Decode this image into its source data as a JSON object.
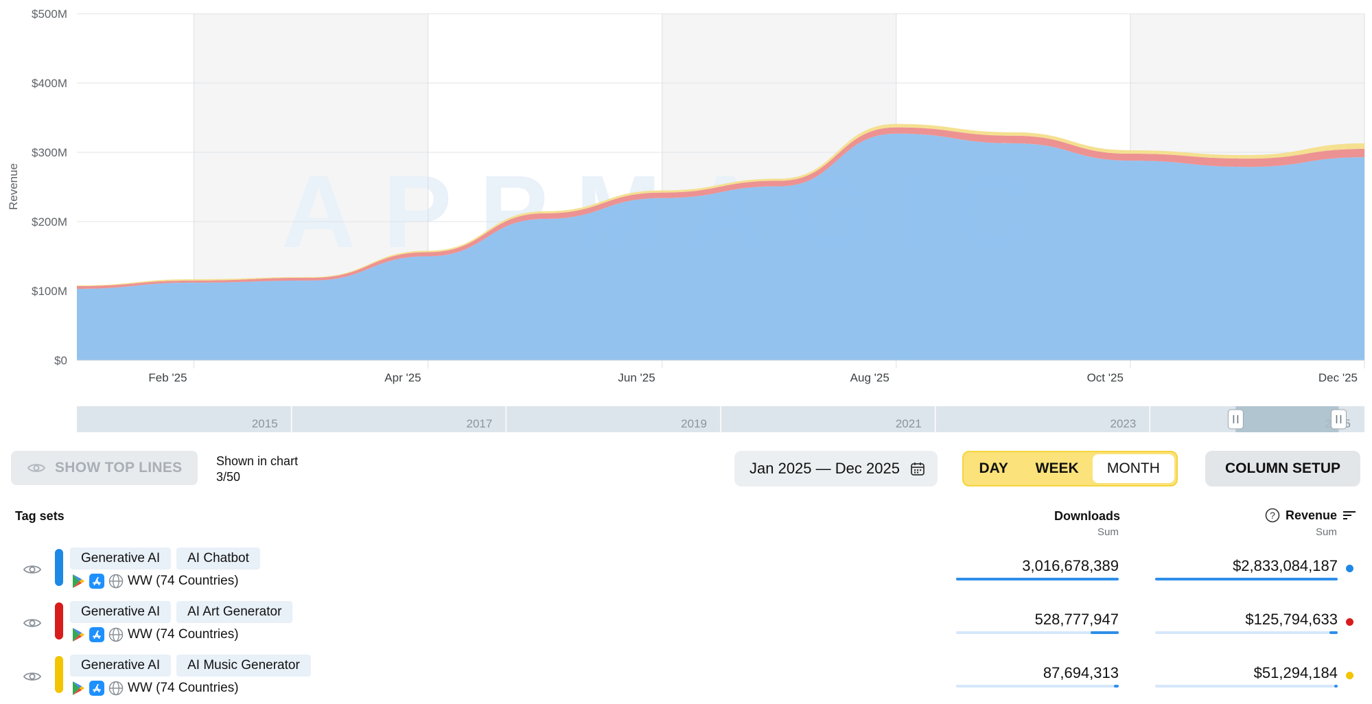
{
  "chart_data": {
    "type": "area",
    "stacked": true,
    "ylabel": "Revenue",
    "y_tick_labels": [
      "$0",
      "$100M",
      "$200M",
      "$300M",
      "$400M",
      "$500M"
    ],
    "ylim": [
      0,
      500
    ],
    "y_unit": "$M",
    "x": [
      "Jan '25",
      "Feb '25",
      "Mar '25",
      "Apr '25",
      "May '25",
      "Jun '25",
      "Jul '25",
      "Aug '25",
      "Sep '25",
      "Oct '25",
      "Nov '25",
      "Dec '25"
    ],
    "x_tick_labels": [
      "Feb '25",
      "Apr '25",
      "Jun '25",
      "Aug '25",
      "Oct '25",
      "Dec '25"
    ],
    "series": [
      {
        "color": "#8dbfee",
        "values": [
          103,
          112,
          115,
          150,
          204,
          234,
          251,
          327,
          313,
          288,
          279,
          293
        ]
      },
      {
        "color": "#ec8c8c",
        "values": [
          4,
          3,
          4,
          6,
          8,
          8,
          8,
          9,
          11,
          10,
          12,
          12
        ]
      },
      {
        "color": "#f3de8a",
        "values": [
          1,
          2,
          1,
          2,
          3,
          3,
          3,
          5,
          5,
          5,
          5,
          8
        ]
      }
    ],
    "grid": true,
    "watermark": "APPMAGIC",
    "navigator": {
      "labels": [
        "2015",
        "2017",
        "2019",
        "2021",
        "2023",
        "2025"
      ],
      "selection_start_fraction": 0.9,
      "selection_end_fraction": 0.98
    }
  },
  "controls": {
    "show_top_lines": "SHOW TOP LINES",
    "shown_in_chart_label": "Shown in chart",
    "shown_in_chart_value": "3/50",
    "date_range": "Jan 2025 — Dec 2025",
    "periods": [
      "DAY",
      "WEEK",
      "MONTH"
    ],
    "active_period": "MONTH",
    "column_setup": "COLUMN SETUP"
  },
  "table": {
    "header": {
      "tag_sets": "Tag sets",
      "downloads": "Downloads",
      "downloads_sub": "Sum",
      "revenue": "Revenue",
      "revenue_sub": "Sum"
    },
    "rows": [
      {
        "color": "#1e88e5",
        "tags": [
          "Generative AI",
          "AI Chatbot"
        ],
        "region": "WW (74 Countries)",
        "downloads": "3,016,678,389",
        "revenue": "$2,833,084,187",
        "downloads_share": 1.0,
        "revenue_share": 1.0
      },
      {
        "color": "#d81b1b",
        "tags": [
          "Generative AI",
          "AI Art Generator"
        ],
        "region": "WW (74 Countries)",
        "downloads": "528,777,947",
        "revenue": "$125,794,633",
        "downloads_share": 0.175,
        "revenue_share": 0.044
      },
      {
        "color": "#f2c500",
        "tags": [
          "Generative AI",
          "AI Music Generator"
        ],
        "region": "WW (74 Countries)",
        "downloads": "87,694,313",
        "revenue": "$51,294,184",
        "downloads_share": 0.029,
        "revenue_share": 0.018
      }
    ]
  }
}
